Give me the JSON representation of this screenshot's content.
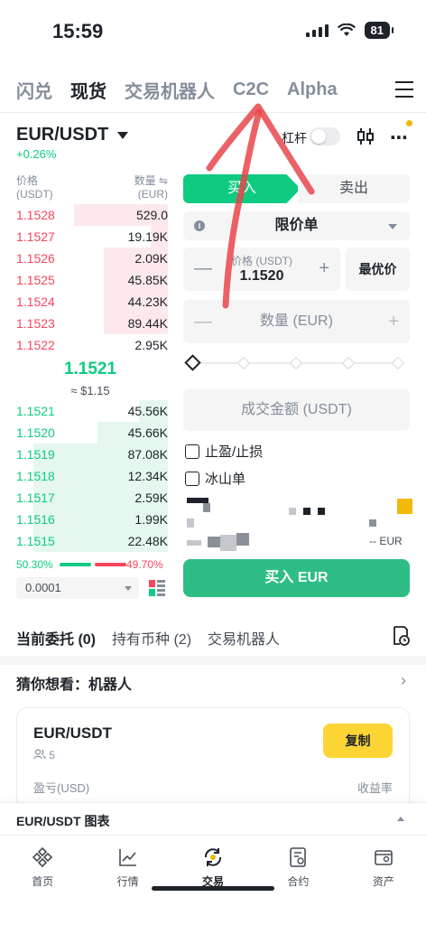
{
  "status_bar": {
    "time": "15:59",
    "battery": "81"
  },
  "top_nav": {
    "tabs": [
      {
        "label": "闪兑",
        "active": false
      },
      {
        "label": "现货",
        "active": true
      },
      {
        "label": "交易机器人",
        "active": false
      },
      {
        "label": "C2C",
        "active": false
      },
      {
        "label": "Alpha",
        "active": false
      }
    ]
  },
  "pair": {
    "symbol": "EUR/USDT",
    "change": "+0.26%",
    "leverage_label": "杠杆",
    "leverage_on": false
  },
  "order_book": {
    "price_header": "价格",
    "price_unit": "(USDT)",
    "qty_header": "数量 ⇋",
    "qty_unit": "(EUR)",
    "asks": [
      {
        "price": "1.1528",
        "qty": "529.0",
        "depth": 0.56
      },
      {
        "price": "1.1527",
        "qty": "19.19K",
        "depth": 0.1
      },
      {
        "price": "1.1526",
        "qty": "2.09K",
        "depth": 0.38
      },
      {
        "price": "1.1525",
        "qty": "45.85K",
        "depth": 0.38
      },
      {
        "price": "1.1524",
        "qty": "44.23K",
        "depth": 0.38
      },
      {
        "price": "1.1523",
        "qty": "89.44K",
        "depth": 0.38
      },
      {
        "price": "1.1522",
        "qty": "2.95K",
        "depth": 0.0
      }
    ],
    "mid_price": "1.1521",
    "mid_fiat": "≈ $1.15",
    "bids": [
      {
        "price": "1.1521",
        "qty": "45.56K",
        "depth": 0.17
      },
      {
        "price": "1.1520",
        "qty": "45.66K",
        "depth": 0.42
      },
      {
        "price": "1.1519",
        "qty": "87.08K",
        "depth": 0.8
      },
      {
        "price": "1.1518",
        "qty": "12.34K",
        "depth": 0.8
      },
      {
        "price": "1.1517",
        "qty": "2.59K",
        "depth": 0.8
      },
      {
        "price": "1.1516",
        "qty": "1.99K",
        "depth": 0.8
      },
      {
        "price": "1.1515",
        "qty": "22.48K",
        "depth": 0.8
      }
    ],
    "buy_ratio": "50.30%",
    "sell_ratio": "49.70%",
    "buy_ratio_value": 0.503,
    "precision": "0.0001"
  },
  "order_form": {
    "buy_tab": "买入",
    "sell_tab": "卖出",
    "order_type": "限价单",
    "price_label": "价格 (USDT)",
    "price_value": "1.1520",
    "best_price": "最优价",
    "qty_placeholder": "数量 (EUR)",
    "slider_value": 0,
    "amount_placeholder": "成交金额 (USDT)",
    "tp_sl": "止盈/止损",
    "iceberg": "冰山单",
    "partial_text": "-- EUR",
    "buy_button": "买入 EUR",
    "minus": "—",
    "plus": "+"
  },
  "orders_tabs": [
    {
      "label": "当前委托 (0)",
      "active": true
    },
    {
      "label": "持有币种 (2)",
      "active": false
    },
    {
      "label": "交易机器人",
      "active": false
    }
  ],
  "suggestion": {
    "title": "猜你想看：机器人",
    "card": {
      "pair": "EUR/USDT",
      "users": "5",
      "copy": "复制",
      "pnl_label": "盈亏(USD)",
      "roi_label": "收益率"
    }
  },
  "chart_strip": {
    "label": "EUR/USDT 图表"
  },
  "tab_bar": [
    {
      "label": "首页",
      "icon": "home-icon",
      "active": false
    },
    {
      "label": "行情",
      "icon": "markets-icon",
      "active": false
    },
    {
      "label": "交易",
      "icon": "trade-icon",
      "active": true
    },
    {
      "label": "合约",
      "icon": "futures-icon",
      "active": false
    },
    {
      "label": "资产",
      "icon": "wallet-icon",
      "active": false
    }
  ],
  "colors": {
    "green": "#0ecb81",
    "red": "#f6465d",
    "yellow": "#fcd535",
    "annotation_red": "#e8454b"
  }
}
